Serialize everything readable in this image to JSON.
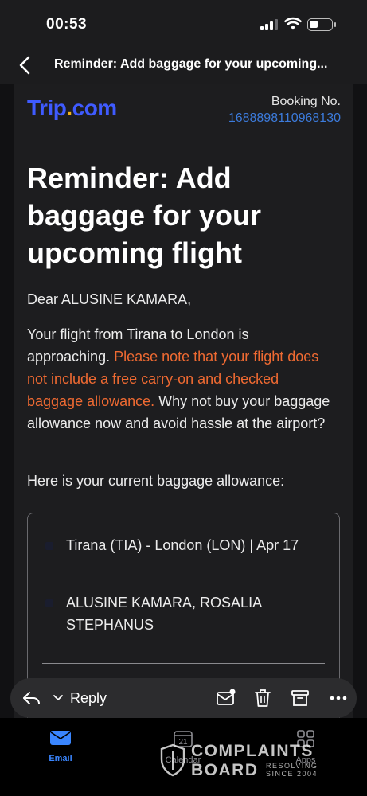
{
  "status_bar": {
    "time": "00:53",
    "battery_level": 0.3
  },
  "nav": {
    "title": "Reminder: Add baggage for your upcoming..."
  },
  "email": {
    "brand": {
      "name_main": "Trip",
      "name_dot": ".",
      "name_tld": "com",
      "color": "#3f5bff"
    },
    "booking_label": "Booking No.",
    "booking_number": "1688898110968130",
    "headline": "Reminder: Add baggage for your upcoming flight",
    "greeting": "Dear ALUSINE KAMARA,",
    "message": {
      "part1": "Your flight from Tirana to London is approaching. ",
      "warning": "Please note that your flight does not include a free carry-on and checked baggage allowance.",
      "part2": " Why not buy your baggage allowance now and avoid hassle at the airport?",
      "warning_color": "#ef6a32"
    },
    "allowance_intro": "Here is your current baggage allowance:",
    "card": {
      "route": "Tirana (TIA) - London (LON)  |  Apr 17",
      "passengers": "ALUSINE KAMARA, ROSALIA STEPHANUS"
    }
  },
  "reply_bar": {
    "reply_label": "Reply",
    "icons": [
      "reply-arrow-icon",
      "chevron-down-icon",
      "envelope-unread-icon",
      "trash-icon",
      "archive-icon",
      "more-icon"
    ]
  },
  "tabs": [
    {
      "label": "Email",
      "icon": "envelope-icon",
      "active": true
    },
    {
      "label": "Calendar",
      "icon": "calendar-icon",
      "day": "21",
      "active": false
    },
    {
      "label": "Apps",
      "icon": "apps-grid-icon",
      "active": false
    }
  ],
  "watermark": {
    "line1": "COMPLAINTS",
    "line2": "BOARD",
    "sub1": "RESOLVING",
    "sub2": "SINCE 2004"
  }
}
